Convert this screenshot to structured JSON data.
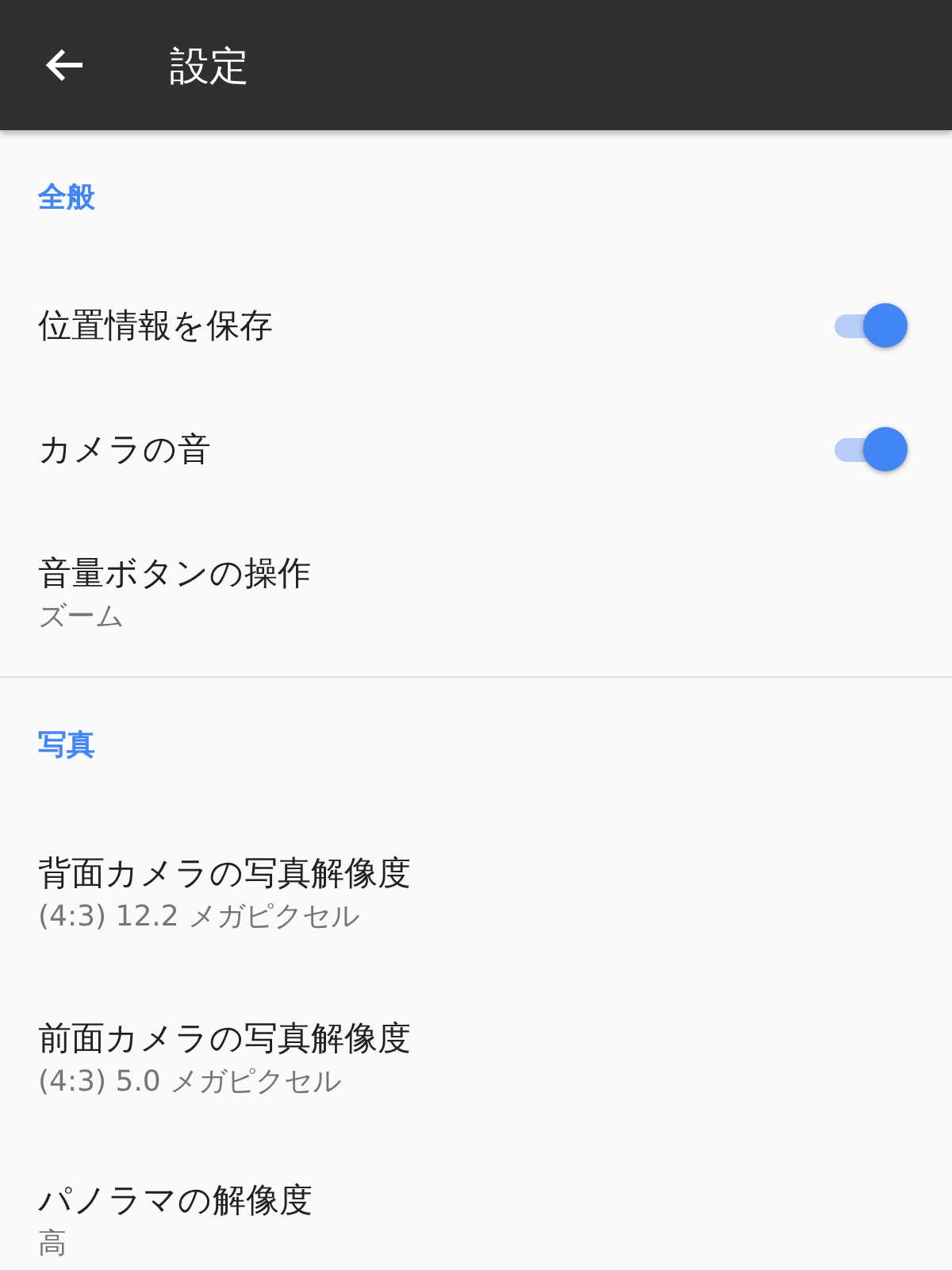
{
  "header": {
    "title": "設定"
  },
  "sections": [
    {
      "title": "全般",
      "items": [
        {
          "kind": "toggle",
          "label": "位置情報を保存",
          "on": true
        },
        {
          "kind": "toggle",
          "label": "カメラの音",
          "on": true
        },
        {
          "kind": "pref",
          "label": "音量ボタンの操作",
          "summary": "ズーム"
        }
      ]
    },
    {
      "title": "写真",
      "items": [
        {
          "kind": "pref",
          "label": "背面カメラの写真解像度",
          "summary": "(4:3) 12.2 メガピクセル"
        },
        {
          "kind": "pref",
          "label": "前面カメラの写真解像度",
          "summary": "(4:3) 5.0 メガピクセル"
        },
        {
          "kind": "pref",
          "label": "パノラマの解像度",
          "summary": "高"
        }
      ]
    }
  ]
}
